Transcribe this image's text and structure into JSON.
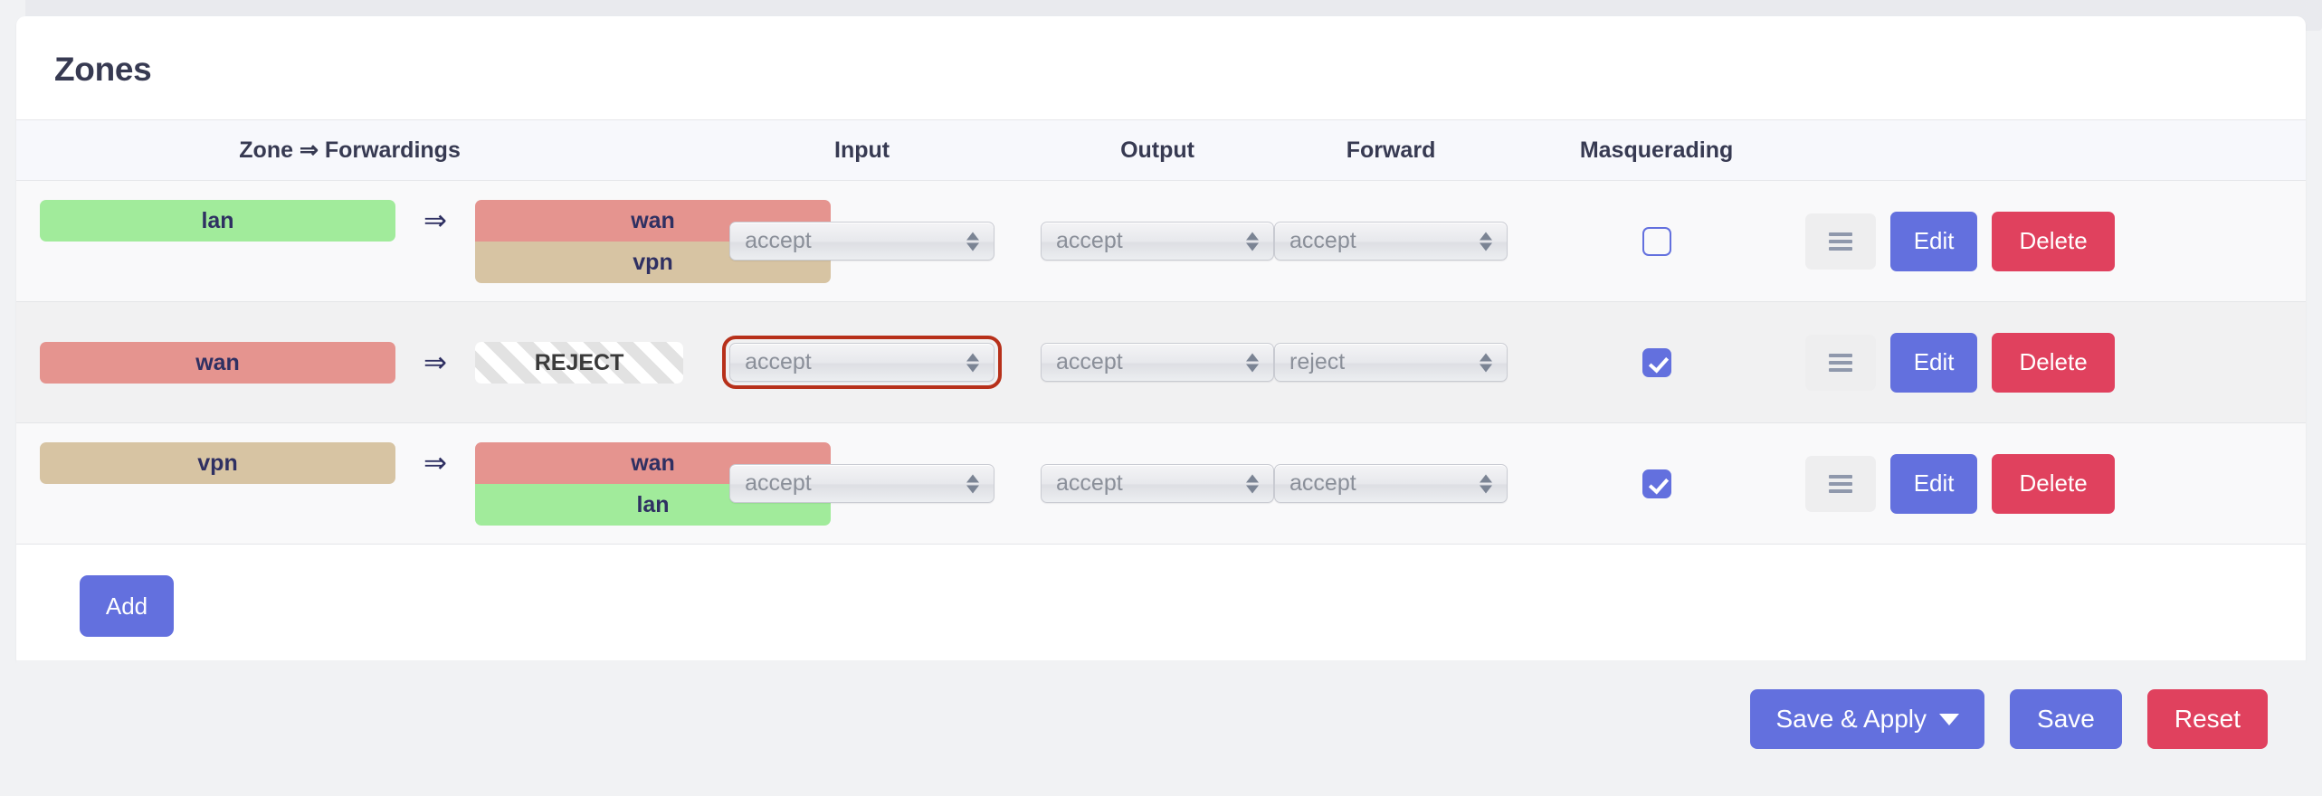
{
  "card": {
    "title": "Zones"
  },
  "table": {
    "headers": {
      "zone": "Zone ⇒ Forwardings",
      "input": "Input",
      "output": "Output",
      "forward": "Forward",
      "masquerading": "Masquerading",
      "actions": ""
    },
    "arrow_glyph": "⇒",
    "rows": [
      {
        "zone": {
          "label": "lan",
          "color": "#a1eb9b"
        },
        "forwardings": [
          {
            "label": "wan",
            "color": "#e5948f"
          },
          {
            "label": "vpn",
            "color": "#d7c4a3"
          }
        ],
        "reject": false,
        "input": "accept",
        "output": "accept",
        "forward": "accept",
        "input_focused": false,
        "masquerading": false,
        "drag_label": "",
        "edit_label": "Edit",
        "delete_label": "Delete"
      },
      {
        "zone": {
          "label": "wan",
          "color": "#e5948f"
        },
        "forwardings": [],
        "reject": true,
        "reject_label": "REJECT",
        "input": "accept",
        "output": "accept",
        "forward": "reject",
        "input_focused": true,
        "masquerading": true,
        "drag_label": "",
        "edit_label": "Edit",
        "delete_label": "Delete"
      },
      {
        "zone": {
          "label": "vpn",
          "color": "#d7c4a3"
        },
        "forwardings": [
          {
            "label": "wan",
            "color": "#e5948f"
          },
          {
            "label": "lan",
            "color": "#a1eb9b"
          }
        ],
        "reject": false,
        "input": "accept",
        "output": "accept",
        "forward": "accept",
        "input_focused": false,
        "masquerading": true,
        "drag_label": "",
        "edit_label": "Edit",
        "delete_label": "Delete"
      }
    ]
  },
  "add_button": {
    "label": "Add"
  },
  "footer": {
    "save_apply_label": "Save & Apply",
    "save_label": "Save",
    "reset_label": "Reset"
  },
  "colors": {
    "accent_indigo": "#6370de",
    "danger_red": "#e0415e",
    "focus_outline": "#b7301a",
    "title_navy": "#373a52",
    "badge_text": "#2f3062"
  }
}
